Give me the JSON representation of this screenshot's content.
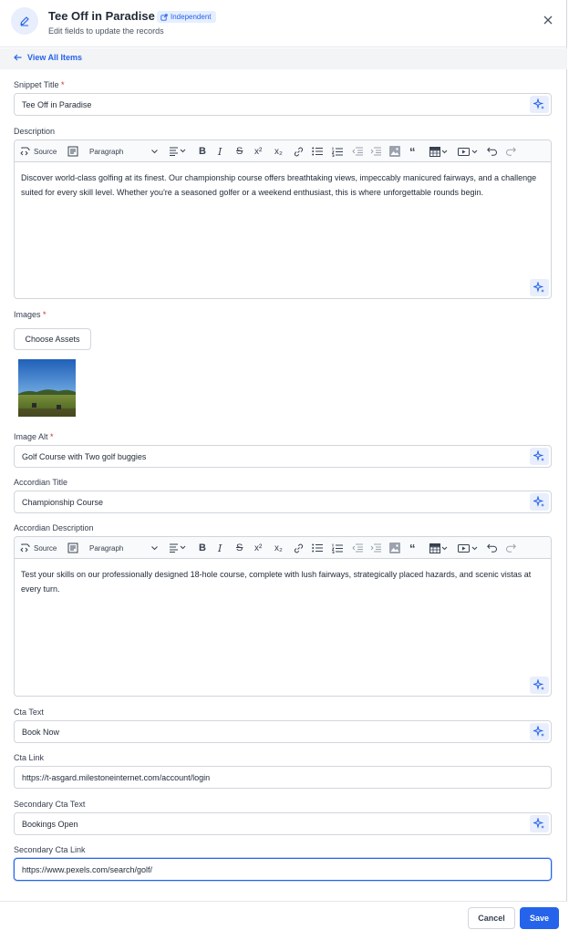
{
  "header": {
    "title": "Tee Off in Paradise",
    "badge": "Independent",
    "subtitle": "Edit fields to update the records",
    "icon": "pencil-icon",
    "close_icon": "close-icon"
  },
  "nav": {
    "back_label": "View All Items"
  },
  "fields": {
    "snippet_title": {
      "label": "Snippet Title",
      "required": "*",
      "value": "Tee Off in Paradise"
    },
    "description": {
      "label": "Description",
      "value": "Discover world-class golfing at its finest. Our championship course offers breathtaking views, impeccably manicured fairways, and a challenge suited for every skill level. Whether you're a seasoned golfer or a weekend enthusiast, this is where unforgettable rounds begin."
    },
    "images": {
      "label": "Images",
      "required": "*",
      "button": "Choose Assets"
    },
    "image_alt": {
      "label": "Image Alt",
      "required": "*",
      "value": "Golf Course with Two golf buggies"
    },
    "accordian_title": {
      "label": "Accordian Title",
      "value": "Championship Course"
    },
    "accordian_description": {
      "label": "Accordian Description",
      "value": "Test your skills on our professionally designed 18-hole course, complete with lush fairways, strategically placed hazards, and scenic vistas at every turn."
    },
    "cta_text": {
      "label": "Cta Text",
      "value": "Book Now"
    },
    "cta_link": {
      "label": "Cta Link",
      "value": "https://t-asgard.milestoneinternet.com/account/login"
    },
    "secondary_cta_text": {
      "label": "Secondary Cta Text",
      "value": "Bookings Open"
    },
    "secondary_cta_link": {
      "label": "Secondary Cta Link",
      "value": "https://www.pexels.com/search/golf/"
    }
  },
  "toolbar": {
    "source": "Source",
    "paragraph": "Paragraph",
    "superscript": "x²",
    "subscript": "x₂"
  },
  "footer": {
    "cancel": "Cancel",
    "save": "Save"
  },
  "colors": {
    "accent": "#2563eb",
    "required": "#dc2626",
    "ai_button_bg": "#e8eefb"
  }
}
